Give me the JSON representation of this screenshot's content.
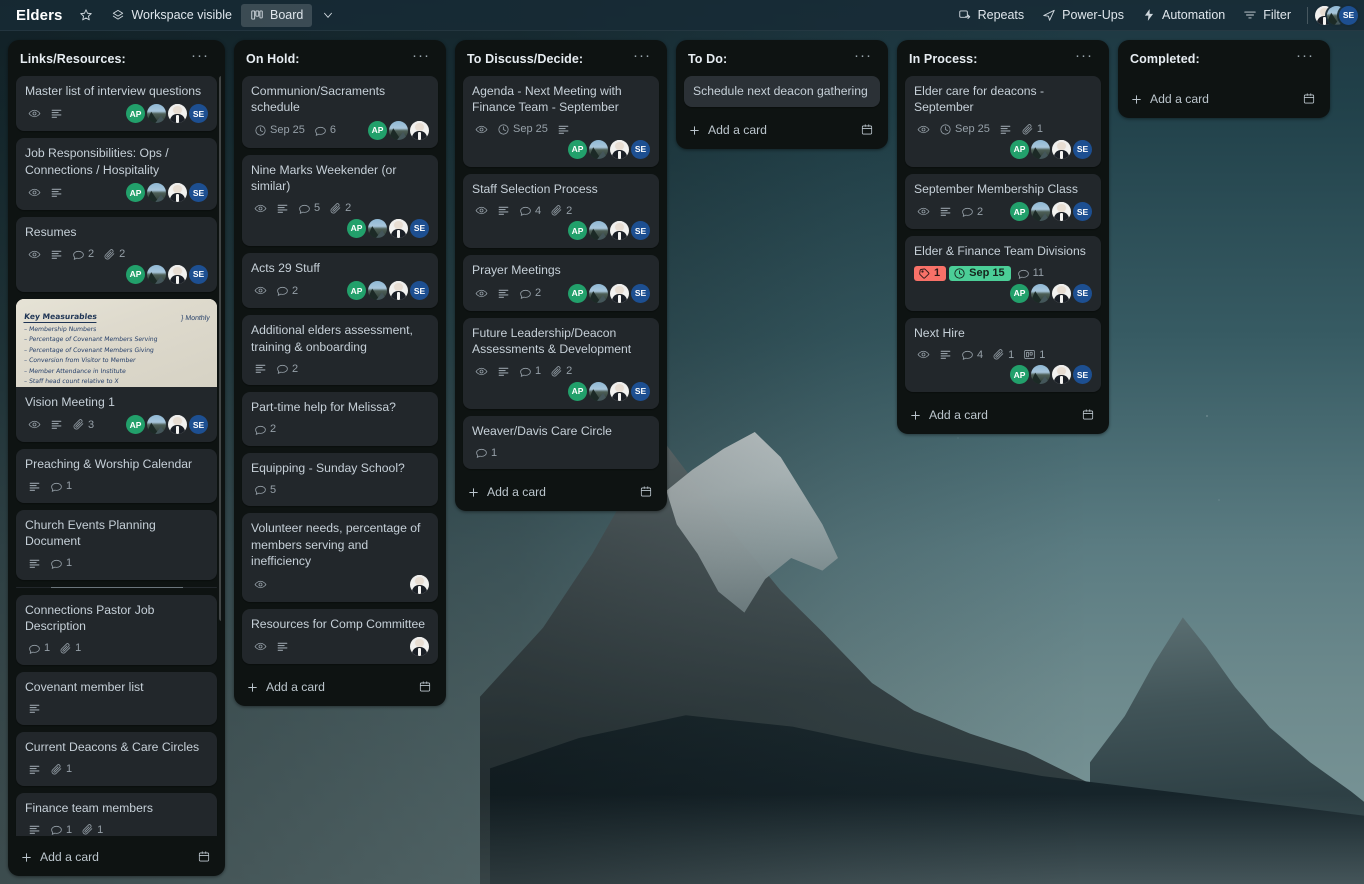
{
  "topbar": {
    "board_name": "Elders",
    "star_icon": "star-icon",
    "visibility_icon": "workspace-icon",
    "visibility_label": "Workspace visible",
    "view_icon": "board-view-icon",
    "view_label": "Board",
    "view_chevron": "chevron-down-icon",
    "repeats_label": "Repeats",
    "repeats_icon": "repeats-icon",
    "powerups_label": "Power-Ups",
    "powerups_icon": "rocket-icon",
    "automation_label": "Automation",
    "automation_icon": "bolt-icon",
    "filter_label": "Filter",
    "filter_icon": "filter-icon",
    "members": [
      {
        "type": "photo-man",
        "initials": ""
      },
      {
        "type": "photo-mtn",
        "initials": ""
      },
      {
        "type": "se",
        "initials": "SE"
      }
    ]
  },
  "add_card_label": "Add a card",
  "lists": [
    {
      "title": "Links/Resources:",
      "menu": "···",
      "has_scrollbar": true,
      "cards": [
        {
          "title": "Master list of interview questions",
          "badges": [
            {
              "kind": "icon",
              "icon": "watch-eye-icon"
            },
            {
              "kind": "icon",
              "icon": "description-icon"
            }
          ],
          "members": [
            "ap",
            "photo-mtn",
            "photo-man",
            "se"
          ],
          "members_inline": true
        },
        {
          "title": "Job Responsibilities: Ops / Connections / Hospitality",
          "badges": [
            {
              "kind": "icon",
              "icon": "watch-eye-icon"
            },
            {
              "kind": "icon",
              "icon": "description-icon"
            }
          ],
          "members": [
            "ap",
            "photo-mtn",
            "photo-man",
            "se"
          ],
          "members_inline": true
        },
        {
          "title": "Resumes",
          "badges": [
            {
              "kind": "icon",
              "icon": "watch-eye-icon"
            },
            {
              "kind": "icon",
              "icon": "description-icon"
            },
            {
              "kind": "count",
              "icon": "comment-icon",
              "value": "2"
            },
            {
              "kind": "count",
              "icon": "attachment-icon",
              "value": "2"
            }
          ],
          "members": [
            "ap",
            "photo-mtn",
            "photo-man",
            "se"
          ],
          "members_inline": false
        },
        {
          "title": "Vision Meeting 1",
          "cover": {
            "type": "whiteboard-photo",
            "heading": "Key Measurables",
            "lines": [
              "– Membership Numbers",
              "– Percentage of Covenant Members Serving",
              "– Percentage of Covenant Members Giving",
              "– Conversion from Visitor to Member",
              "– Member Attendance in Institute",
              "– Staff head count relative to X"
            ],
            "annotation": "Monthly"
          },
          "badges": [
            {
              "kind": "icon",
              "icon": "watch-eye-icon"
            },
            {
              "kind": "icon",
              "icon": "description-icon"
            },
            {
              "kind": "count",
              "icon": "attachment-icon",
              "value": "3"
            }
          ],
          "members": [
            "ap",
            "photo-mtn",
            "photo-man",
            "se"
          ],
          "members_inline": true
        },
        {
          "title": "Preaching & Worship Calendar",
          "badges": [
            {
              "kind": "icon",
              "icon": "description-icon"
            },
            {
              "kind": "count",
              "icon": "comment-icon",
              "value": "1"
            }
          ],
          "members": []
        },
        {
          "title": "Church Events Planning Document",
          "badges": [
            {
              "kind": "icon",
              "icon": "description-icon"
            },
            {
              "kind": "count",
              "icon": "comment-icon",
              "value": "1"
            }
          ],
          "members": []
        },
        {
          "title": "",
          "separator": true,
          "badges": [],
          "members": []
        },
        {
          "title": "Connections Pastor Job Description",
          "badges": [
            {
              "kind": "count",
              "icon": "comment-icon",
              "value": "1"
            },
            {
              "kind": "count",
              "icon": "attachment-icon",
              "value": "1"
            }
          ],
          "members": []
        },
        {
          "title": "Covenant member list",
          "badges": [
            {
              "kind": "icon",
              "icon": "description-icon"
            }
          ],
          "members": []
        },
        {
          "title": "Current Deacons & Care Circles",
          "badges": [
            {
              "kind": "icon",
              "icon": "description-icon"
            },
            {
              "kind": "count",
              "icon": "attachment-icon",
              "value": "1"
            }
          ],
          "members": []
        },
        {
          "title": "Finance team members",
          "badges": [
            {
              "kind": "icon",
              "icon": "description-icon"
            },
            {
              "kind": "count",
              "icon": "comment-icon",
              "value": "1"
            },
            {
              "kind": "count",
              "icon": "attachment-icon",
              "value": "1"
            }
          ],
          "members": []
        }
      ]
    },
    {
      "title": "On Hold:",
      "menu": "···",
      "cards": [
        {
          "title": "Communion/Sacraments schedule",
          "badges": [
            {
              "kind": "count",
              "icon": "clock-icon",
              "value": "Sep 25"
            },
            {
              "kind": "count",
              "icon": "comment-icon",
              "value": "6"
            }
          ],
          "members": [
            "ap",
            "photo-mtn",
            "photo-man"
          ],
          "members_inline": true
        },
        {
          "title": "Nine Marks Weekender (or similar)",
          "badges": [
            {
              "kind": "icon",
              "icon": "watch-eye-icon"
            },
            {
              "kind": "icon",
              "icon": "description-icon"
            },
            {
              "kind": "count",
              "icon": "comment-icon",
              "value": "5"
            },
            {
              "kind": "count",
              "icon": "attachment-icon",
              "value": "2"
            }
          ],
          "members": [
            "ap",
            "photo-mtn",
            "photo-man",
            "se"
          ],
          "members_inline": false
        },
        {
          "title": "Acts 29 Stuff",
          "badges": [
            {
              "kind": "icon",
              "icon": "watch-eye-icon"
            },
            {
              "kind": "count",
              "icon": "comment-icon",
              "value": "2"
            }
          ],
          "members": [
            "ap",
            "photo-mtn",
            "photo-man",
            "se"
          ],
          "members_inline": true
        },
        {
          "title": "Additional elders assessment, training & onboarding",
          "badges": [
            {
              "kind": "icon",
              "icon": "description-icon"
            },
            {
              "kind": "count",
              "icon": "comment-icon",
              "value": "2"
            }
          ],
          "members": []
        },
        {
          "title": "Part-time help for Melissa?",
          "badges": [
            {
              "kind": "count",
              "icon": "comment-icon",
              "value": "2"
            }
          ],
          "members": []
        },
        {
          "title": "Equipping - Sunday School?",
          "badges": [
            {
              "kind": "count",
              "icon": "comment-icon",
              "value": "5"
            }
          ],
          "members": []
        },
        {
          "title": "Volunteer needs, percentage of members serving and inefficiency",
          "badges": [
            {
              "kind": "icon",
              "icon": "watch-eye-icon"
            }
          ],
          "members": [
            "photo-man"
          ],
          "members_inline": true
        },
        {
          "title": "Resources for Comp Committee",
          "badges": [
            {
              "kind": "icon",
              "icon": "watch-eye-icon"
            },
            {
              "kind": "icon",
              "icon": "description-icon"
            }
          ],
          "members": [
            "photo-man"
          ],
          "members_inline": true
        }
      ]
    },
    {
      "title": "To Discuss/Decide:",
      "menu": "···",
      "cards": [
        {
          "title": "Agenda - Next Meeting with Finance Team - September",
          "badges": [
            {
              "kind": "icon",
              "icon": "watch-eye-icon"
            },
            {
              "kind": "count",
              "icon": "clock-icon",
              "value": "Sep 25"
            },
            {
              "kind": "icon",
              "icon": "description-icon"
            }
          ],
          "members": [
            "ap",
            "photo-mtn",
            "photo-man",
            "se"
          ],
          "members_inline": false
        },
        {
          "title": "Staff Selection Process",
          "badges": [
            {
              "kind": "icon",
              "icon": "watch-eye-icon"
            },
            {
              "kind": "icon",
              "icon": "description-icon"
            },
            {
              "kind": "count",
              "icon": "comment-icon",
              "value": "4"
            },
            {
              "kind": "count",
              "icon": "attachment-icon",
              "value": "2"
            }
          ],
          "members": [
            "ap",
            "photo-mtn",
            "photo-man",
            "se"
          ],
          "members_inline": false
        },
        {
          "title": "Prayer Meetings",
          "badges": [
            {
              "kind": "icon",
              "icon": "watch-eye-icon"
            },
            {
              "kind": "icon",
              "icon": "description-icon"
            },
            {
              "kind": "count",
              "icon": "comment-icon",
              "value": "2"
            }
          ],
          "members": [
            "ap",
            "photo-mtn",
            "photo-man",
            "se"
          ],
          "members_inline": true
        },
        {
          "title": "Future Leadership/Deacon Assessments & Development",
          "badges": [
            {
              "kind": "icon",
              "icon": "watch-eye-icon"
            },
            {
              "kind": "icon",
              "icon": "description-icon"
            },
            {
              "kind": "count",
              "icon": "comment-icon",
              "value": "1"
            },
            {
              "kind": "count",
              "icon": "attachment-icon",
              "value": "2"
            }
          ],
          "members": [
            "ap",
            "photo-mtn",
            "photo-man",
            "se"
          ],
          "members_inline": false
        },
        {
          "title": "Weaver/Davis Care Circle",
          "badges": [
            {
              "kind": "count",
              "icon": "comment-icon",
              "value": "1"
            }
          ],
          "members": []
        }
      ]
    },
    {
      "title": "To Do:",
      "menu": "···",
      "cards": [
        {
          "title": "Schedule next deacon gathering",
          "hovered": true,
          "badges": [],
          "members": []
        }
      ]
    },
    {
      "title": "In Process:",
      "menu": "···",
      "cards": [
        {
          "title": "Elder care for deacons - September",
          "badges": [
            {
              "kind": "icon",
              "icon": "watch-eye-icon"
            },
            {
              "kind": "count",
              "icon": "clock-icon",
              "value": "Sep 25"
            },
            {
              "kind": "icon",
              "icon": "description-icon"
            },
            {
              "kind": "count",
              "icon": "attachment-icon",
              "value": "1"
            }
          ],
          "members": [
            "ap",
            "photo-mtn",
            "photo-man",
            "se"
          ],
          "members_inline": false
        },
        {
          "title": "September Membership Class",
          "badges": [
            {
              "kind": "icon",
              "icon": "watch-eye-icon"
            },
            {
              "kind": "icon",
              "icon": "description-icon"
            },
            {
              "kind": "count",
              "icon": "comment-icon",
              "value": "2"
            }
          ],
          "members": [
            "ap",
            "photo-mtn",
            "photo-man",
            "se"
          ],
          "members_inline": true
        },
        {
          "title": "Elder & Finance Team Divisions",
          "badges": [
            {
              "kind": "pill",
              "style": "red",
              "icon": "label-tag-icon",
              "value": "1"
            },
            {
              "kind": "pill",
              "style": "due-green",
              "icon": "clock-icon",
              "value": "Sep 15"
            },
            {
              "kind": "count",
              "icon": "comment-icon",
              "value": "11"
            }
          ],
          "members": [
            "ap",
            "photo-mtn",
            "photo-man",
            "se"
          ],
          "members_inline": false
        },
        {
          "title": "Next Hire",
          "badges": [
            {
              "kind": "icon",
              "icon": "watch-eye-icon"
            },
            {
              "kind": "icon",
              "icon": "description-icon"
            },
            {
              "kind": "count",
              "icon": "comment-icon",
              "value": "4"
            },
            {
              "kind": "count",
              "icon": "attachment-icon",
              "value": "1"
            },
            {
              "kind": "count",
              "icon": "board-link-icon",
              "value": "1"
            }
          ],
          "members": [
            "ap",
            "photo-mtn",
            "photo-man",
            "se"
          ],
          "members_inline": false
        }
      ]
    },
    {
      "title": "Completed:",
      "menu": "···",
      "cards": []
    }
  ],
  "colors": {
    "list_bg": "#0e1312",
    "card_bg": "#22272b",
    "due_green": "#4bce97",
    "label_red": "#f87168",
    "avatar_green": "#22a06b",
    "avatar_blue": "#1d4f91",
    "topbar_bg": "#172b36"
  }
}
